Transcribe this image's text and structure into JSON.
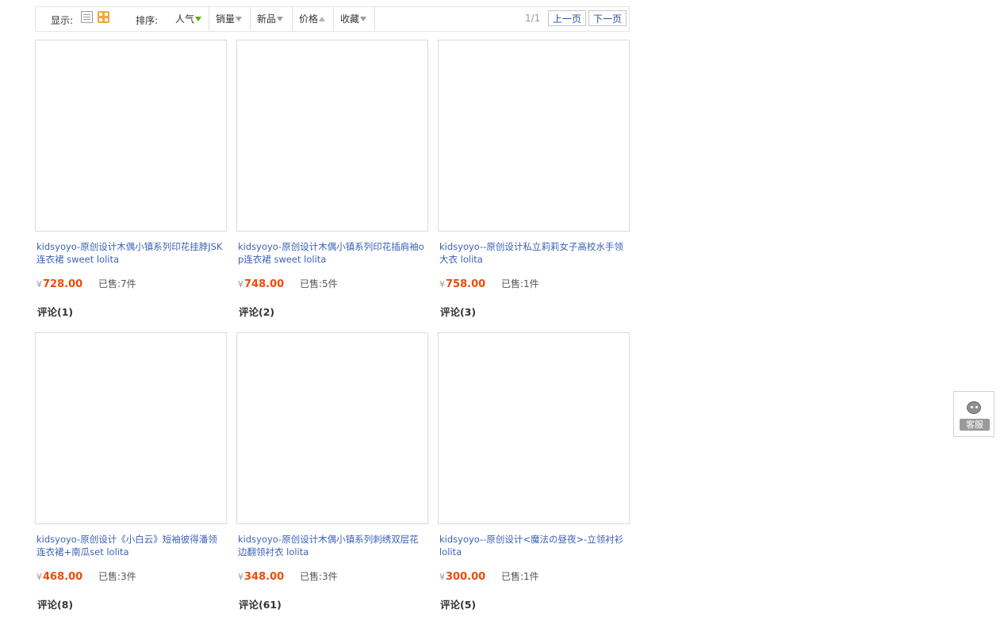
{
  "toolbar": {
    "display_label": "显示:",
    "sort_label": "排序:",
    "sort_items": [
      {
        "label": "人气",
        "direction": "down",
        "active": true
      },
      {
        "label": "销量",
        "direction": "down",
        "active": false
      },
      {
        "label": "新品",
        "direction": "down",
        "active": false
      },
      {
        "label": "价格",
        "direction": "up",
        "active": false
      },
      {
        "label": "收藏",
        "direction": "down",
        "active": false
      }
    ],
    "page_info": "1/1",
    "prev_label": "上一页",
    "next_label": "下一页",
    "icons": {
      "list_view": "list-view-icon",
      "grid_view": "grid-view-icon"
    },
    "colors": {
      "grid_active": "#f1a740",
      "sort_active_arrow": "#63a60c"
    }
  },
  "products": [
    {
      "title": "kidsyoyo-原创设计木偶小镇系列印花挂脖JSK连衣裙 sweet lolita",
      "currency": "¥",
      "price": "728.00",
      "sold_label": "已售:",
      "sold": "7件",
      "reviews": "评论(1)"
    },
    {
      "title": "kidsyoyo-原创设计木偶小镇系列印花插肩袖op连衣裙 sweet lolita",
      "currency": "¥",
      "price": "748.00",
      "sold_label": "已售:",
      "sold": "5件",
      "reviews": "评论(2)"
    },
    {
      "title": "kidsyoyo--原创设计私立莉莉女子高校水手领大衣 lolita",
      "currency": "¥",
      "price": "758.00",
      "sold_label": "已售:",
      "sold": "1件",
      "reviews": "评论(3)"
    },
    {
      "title": "kidsyoyo-原创设计《小白云》短袖彼得潘领连衣裙+南瓜set lolita",
      "currency": "¥",
      "price": "468.00",
      "sold_label": "已售:",
      "sold": "3件",
      "reviews": "评论(8)"
    },
    {
      "title": "kidsyoyo-原创设计木偶小镇系列刺绣双层花边翻领衬衣 lolita",
      "currency": "¥",
      "price": "348.00",
      "sold_label": "已售:",
      "sold": "3件",
      "reviews": "评论(61)"
    },
    {
      "title": "kidsyoyo--原创设计<魔法の昼夜>-立领衬衫 lolita",
      "currency": "¥",
      "price": "300.00",
      "sold_label": "已售:",
      "sold": "1件",
      "reviews": "评论(5)"
    }
  ],
  "customer_service": {
    "label": "客服",
    "icon": "customer-service-icon"
  },
  "colors": {
    "price": "#f04a0a",
    "link": "#3b61b6"
  }
}
